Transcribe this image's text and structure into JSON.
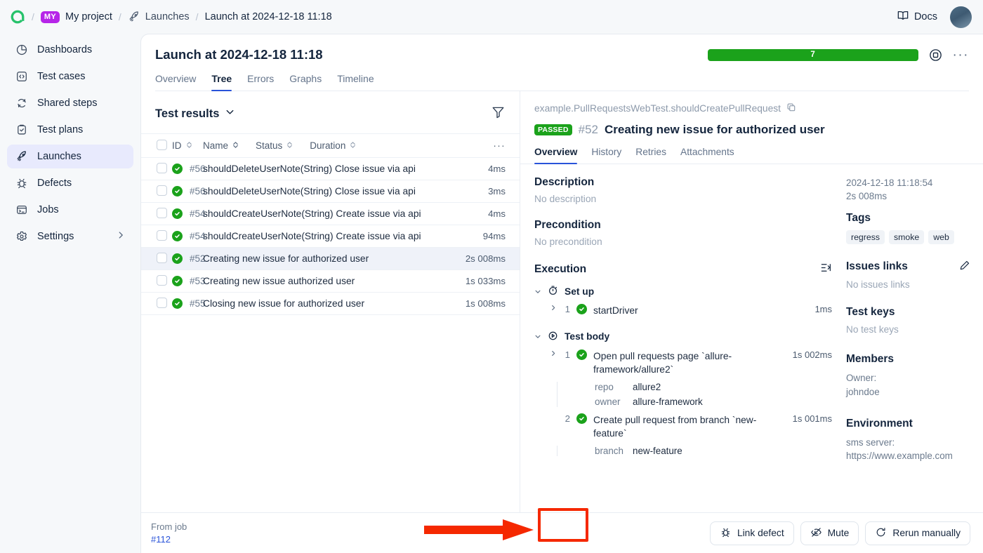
{
  "topbar": {
    "logo_icon": "allure-logo-icon",
    "project_badge": "MY",
    "project_name": "My project",
    "section_icon": "rocket-icon",
    "section_name": "Launches",
    "current": "Launch at 2024-12-18 11:18",
    "separator": "/",
    "docs_label": "Docs",
    "docs_icon": "book-icon",
    "avatar_icon": "user-avatar"
  },
  "sidebar": {
    "items": [
      {
        "label": "Dashboards",
        "icon": "pie-chart-icon",
        "active": false
      },
      {
        "label": "Test cases",
        "icon": "code-icon",
        "active": false
      },
      {
        "label": "Shared steps",
        "icon": "refresh-icon",
        "active": false
      },
      {
        "label": "Test plans",
        "icon": "clipboard-check-icon",
        "active": false
      },
      {
        "label": "Launches",
        "icon": "rocket-icon",
        "active": true
      },
      {
        "label": "Defects",
        "icon": "bug-icon",
        "active": false
      },
      {
        "label": "Jobs",
        "icon": "terminal-icon",
        "active": false
      },
      {
        "label": "Settings",
        "icon": "gear-icon",
        "active": false,
        "chevron": "chevron-right-icon"
      }
    ]
  },
  "launch": {
    "title": "Launch at 2024-12-18 11:18",
    "progress_count": "7",
    "progress_color": "#1ba21b",
    "stop_icon": "stop-record-icon",
    "more_icon": "ellipsis-icon",
    "tabs": [
      {
        "label": "Overview",
        "active": false
      },
      {
        "label": "Tree",
        "active": true
      },
      {
        "label": "Errors",
        "active": false
      },
      {
        "label": "Graphs",
        "active": false
      },
      {
        "label": "Timeline",
        "active": false
      }
    ]
  },
  "tree": {
    "heading": "Test results",
    "heading_chevron": "chevron-down-icon",
    "filter_icon": "funnel-icon",
    "columns": [
      "ID",
      "Name",
      "Status",
      "Duration"
    ],
    "more_icon": "ellipsis-icon",
    "rows": [
      {
        "id": "#56",
        "name": "shouldDeleteUserNote(String) Close issue via api",
        "duration": "4ms",
        "status": "passed",
        "selected": false
      },
      {
        "id": "#56",
        "name": "shouldDeleteUserNote(String) Close issue via api",
        "duration": "3ms",
        "status": "passed",
        "selected": false
      },
      {
        "id": "#54",
        "name": "shouldCreateUserNote(String) Create issue via api",
        "duration": "4ms",
        "status": "passed",
        "selected": false
      },
      {
        "id": "#54",
        "name": "shouldCreateUserNote(String) Create issue via api",
        "duration": "94ms",
        "status": "passed",
        "selected": false
      },
      {
        "id": "#52",
        "name": "Creating new issue for authorized user",
        "duration": "2s 008ms",
        "status": "passed",
        "selected": true
      },
      {
        "id": "#53",
        "name": "Creating new issue authorized user",
        "duration": "1s 033ms",
        "status": "passed",
        "selected": false
      },
      {
        "id": "#55",
        "name": "Closing new issue for authorized user",
        "duration": "1s 008ms",
        "status": "passed",
        "selected": false
      }
    ]
  },
  "detail": {
    "fullname": "example.PullRequestsWebTest.shouldCreatePullRequest",
    "copy_icon": "copy-icon",
    "status_badge": "PASSED",
    "status_color": "#1ba21b",
    "test_id": "#52",
    "test_name": "Creating new issue for authorized user",
    "tabs": [
      {
        "label": "Overview",
        "active": true
      },
      {
        "label": "History",
        "active": false
      },
      {
        "label": "Retries",
        "active": false
      },
      {
        "label": "Attachments",
        "active": false
      }
    ],
    "description_heading": "Description",
    "description_value": "No description",
    "precondition_heading": "Precondition",
    "precondition_value": "No precondition",
    "execution_heading": "Execution",
    "execution_icon": "expand-steps-icon",
    "groups": [
      {
        "name": "Set up",
        "icon": "timer-icon",
        "expanded": true,
        "steps": [
          {
            "num": "1",
            "name": "startDriver",
            "duration": "1ms",
            "status": "passed",
            "twisty": "chevron-right-icon",
            "params": []
          }
        ]
      },
      {
        "name": "Test body",
        "icon": "play-circle-icon",
        "expanded": true,
        "steps": [
          {
            "num": "1",
            "name": "Open pull requests page `allure-framework/allure2`",
            "duration": "1s 002ms",
            "status": "passed",
            "twisty": "chevron-right-icon",
            "params": [
              {
                "key": "repo",
                "value": "allure2"
              },
              {
                "key": "owner",
                "value": "allure-framework"
              }
            ]
          },
          {
            "num": "2",
            "name": "Create pull request from branch `new-feature`",
            "duration": "1s 001ms",
            "status": "passed",
            "params": [
              {
                "key": "branch",
                "value": "new-feature"
              }
            ]
          }
        ]
      }
    ]
  },
  "side": {
    "timestamp": "2024-12-18 11:18:54",
    "duration": "2s 008ms",
    "tags_heading": "Tags",
    "tags": [
      "regress",
      "smoke",
      "web"
    ],
    "issues_heading": "Issues links",
    "issues_edit_icon": "pencil-icon",
    "issues_empty": "No issues links",
    "testkeys_heading": "Test keys",
    "testkeys_empty": "No test keys",
    "members_heading": "Members",
    "members_owner_label": "Owner:",
    "members_owner_value": "johndoe",
    "environment_heading": "Environment",
    "environment_key": "sms server:",
    "environment_value": "https://www.example.com"
  },
  "bottom": {
    "from_job_label": "From job",
    "from_job_number": "#112",
    "buttons": [
      {
        "label": "Link defect",
        "icon": "bug-icon"
      },
      {
        "label": "Mute",
        "icon": "eye-off-icon"
      },
      {
        "label": "Rerun manually",
        "icon": "rerun-icon"
      }
    ]
  },
  "annotation": {
    "box_color": "#f52800",
    "arrow_color": "#f52800",
    "target": "#112"
  }
}
